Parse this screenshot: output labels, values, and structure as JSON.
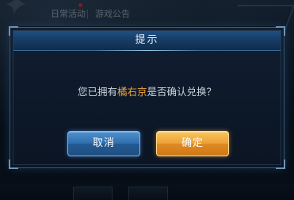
{
  "background": {
    "tabs": [
      {
        "label": "日常活动"
      },
      {
        "label": "游戏公告"
      }
    ]
  },
  "dialog": {
    "title": "提示",
    "message_prefix": "您已拥有",
    "message_highlight": "橘右京",
    "message_suffix": "是否确认兑换？",
    "cancel_label": "取消",
    "confirm_label": "确定"
  },
  "colors": {
    "highlight": "#f0a33a",
    "cancel_button": "#2f6fae",
    "confirm_button": "#eea238",
    "header": "#1f4f82"
  }
}
